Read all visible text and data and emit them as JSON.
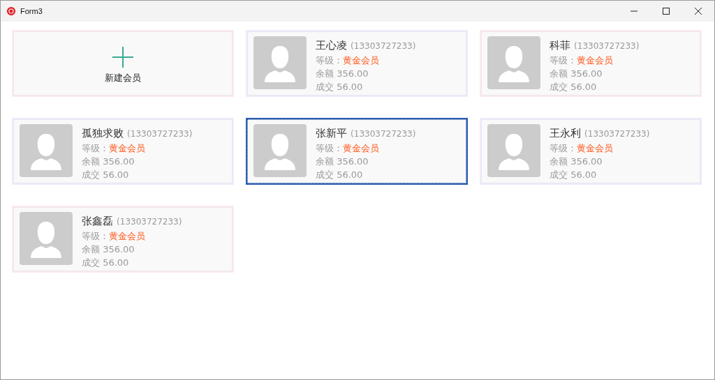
{
  "window": {
    "title": "Form3"
  },
  "new_member": {
    "label": "新建会员",
    "color": "#fde9ec"
  },
  "members": [
    {
      "name": "王心凌",
      "phone": "(13303727233)",
      "level_label": "等级：",
      "level": "黄金会员",
      "balance": "余额 356.00",
      "deals": "成交 56.00",
      "color": "#ececfb",
      "selected": false
    },
    {
      "name": "科菲",
      "phone": "(13303727233)",
      "level_label": "等级：",
      "level": "黄金会员",
      "balance": "余额 356.00",
      "deals": "成交 56.00",
      "color": "#fde9ec",
      "selected": false
    },
    {
      "name": "孤独求败",
      "phone": "(13303727233)",
      "level_label": "等级：",
      "level": "黄金会员",
      "balance": "余额 356.00",
      "deals": "成交 56.00",
      "color": "#ececfb",
      "selected": false
    },
    {
      "name": "张新平",
      "phone": "(13303727233)",
      "level_label": "等级：",
      "level": "黄金会员",
      "balance": "余额 356.00",
      "deals": "成交 56.00",
      "selected": true
    },
    {
      "name": "王永利",
      "phone": "(13303727233)",
      "level_label": "等级：",
      "level": "黄金会员",
      "balance": "余额 356.00",
      "deals": "成交 56.00",
      "color": "#ececfb",
      "selected": false
    },
    {
      "name": "张鑫磊",
      "phone": "(13303727233)",
      "level_label": "等级：",
      "level": "黄金会员",
      "balance": "余额 356.00",
      "deals": "成交 56.00",
      "color": "#fde9ec",
      "selected": false
    }
  ]
}
